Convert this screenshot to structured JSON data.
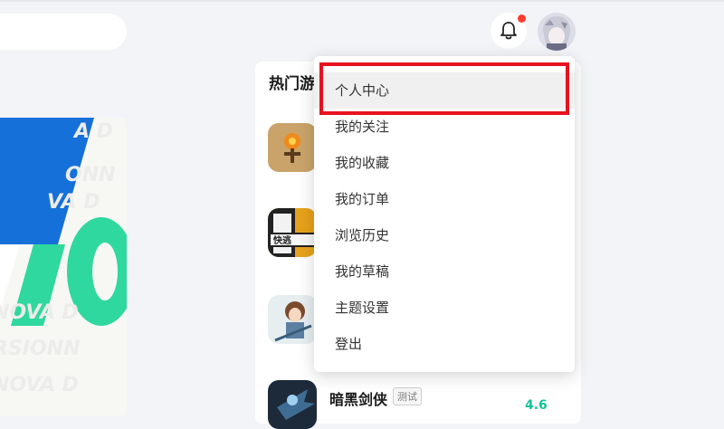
{
  "header": {
    "notification_icon": "bell-icon",
    "has_unread": true,
    "avatar_icon": "user-avatar"
  },
  "panel": {
    "title": "热门游",
    "games": [
      {
        "name": "",
        "icon": "campfire-game-icon"
      },
      {
        "name": "",
        "icon": "kuaitao-game-icon",
        "icon_text": "快逃"
      },
      {
        "name": "",
        "icon": "anime-girl-game-icon"
      },
      {
        "name": "暗黑剑侠",
        "tag": "测试",
        "icon": "dark-swordsman-game-icon",
        "value": "4.6"
      }
    ]
  },
  "banner": {
    "decor_text": "NOVA D"
  },
  "user_menu": {
    "items": [
      {
        "label": "个人中心",
        "highlighted": true
      },
      {
        "label": "我的关注"
      },
      {
        "label": "我的收藏"
      },
      {
        "label": "我的订单"
      },
      {
        "label": "浏览历史"
      },
      {
        "label": "我的草稿"
      },
      {
        "label": "主题设置"
      },
      {
        "label": "登出"
      }
    ]
  },
  "colors": {
    "highlight_border": "#e8121f",
    "accent_teal": "#15c39a",
    "accent_blue": "#1570d9",
    "badge_red": "#ff3b30"
  }
}
